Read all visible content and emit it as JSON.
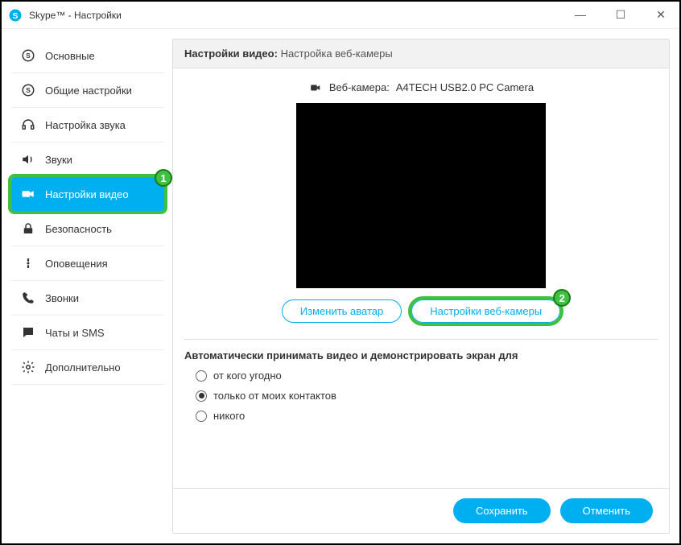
{
  "window": {
    "title": "Skype™ - Настройки"
  },
  "sidebar": {
    "items": [
      {
        "label": "Основные",
        "icon": "skype"
      },
      {
        "label": "Общие настройки",
        "icon": "skype"
      },
      {
        "label": "Настройка звука",
        "icon": "headset"
      },
      {
        "label": "Звуки",
        "icon": "speaker"
      },
      {
        "label": "Настройки видео",
        "icon": "camera",
        "active": true,
        "badge": "1"
      },
      {
        "label": "Безопасность",
        "icon": "lock"
      },
      {
        "label": "Оповещения",
        "icon": "info"
      },
      {
        "label": "Звонки",
        "icon": "phone"
      },
      {
        "label": "Чаты и SMS",
        "icon": "chat"
      },
      {
        "label": "Дополнительно",
        "icon": "gear"
      }
    ]
  },
  "panel": {
    "header_title": "Настройки видео:",
    "header_sub": "Настройка веб-камеры",
    "webcam_label": "Веб-камера:",
    "webcam_name": "A4TECH USB2.0 PC Camera",
    "change_avatar_btn": "Изменить аватар",
    "webcam_settings_btn": "Настройки веб-камеры",
    "webcam_settings_badge": "2",
    "auto_accept_label": "Автоматически принимать видео и демонстрировать экран для",
    "radio_options": [
      {
        "label": "от кого угодно",
        "checked": false
      },
      {
        "label": "только от моих контактов",
        "checked": true
      },
      {
        "label": "никого",
        "checked": false
      }
    ]
  },
  "footer": {
    "save": "Сохранить",
    "cancel": "Отменить"
  }
}
